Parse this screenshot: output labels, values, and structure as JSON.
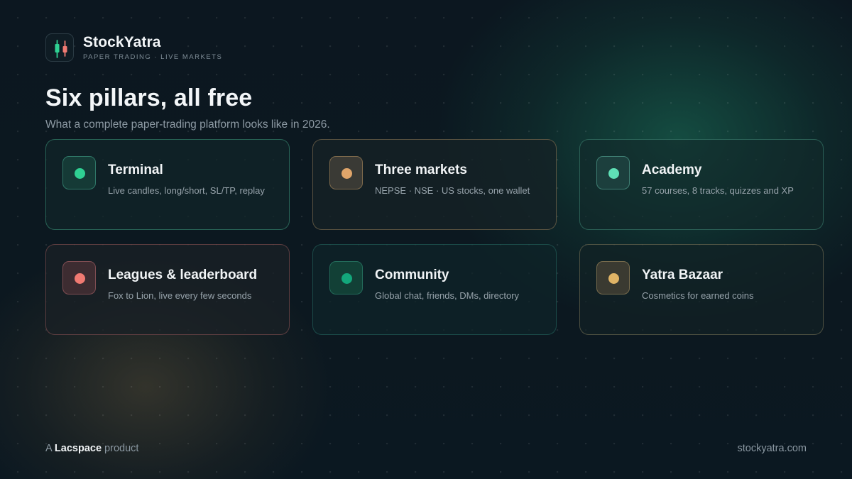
{
  "brand": {
    "name": "StockYatra",
    "tagline": "PAPER TRADING · LIVE MARKETS",
    "logo_icon": "candlestick-icon",
    "colors": {
      "up": "#2fd193",
      "down": "#f07a72"
    }
  },
  "hero": {
    "title": "Six pillars, all free",
    "subtitle": "What a complete paper-trading platform looks like in 2026."
  },
  "pillars": [
    {
      "title": "Terminal",
      "description": "Live candles, long/short, SL/TP, replay",
      "accent": "#2fd193"
    },
    {
      "title": "Three markets",
      "description": "NEPSE · NSE · US stocks, one wallet",
      "accent": "#e0a56a"
    },
    {
      "title": "Academy",
      "description": "57 courses, 8 tracks, quizzes and XP",
      "accent": "#5fe0b6"
    },
    {
      "title": "Leagues & leaderboard",
      "description": "Fox to Lion, live every few seconds",
      "accent": "#f07a72"
    },
    {
      "title": "Community",
      "description": "Global chat, friends, DMs, directory",
      "accent": "#13a77b"
    },
    {
      "title": "Yatra Bazaar",
      "description": "Cosmetics for earned coins",
      "accent": "#e0b466"
    }
  ],
  "footer": {
    "prefix": "A",
    "company": "Lacspace",
    "suffix": "product",
    "website": "stockyatra.com"
  }
}
